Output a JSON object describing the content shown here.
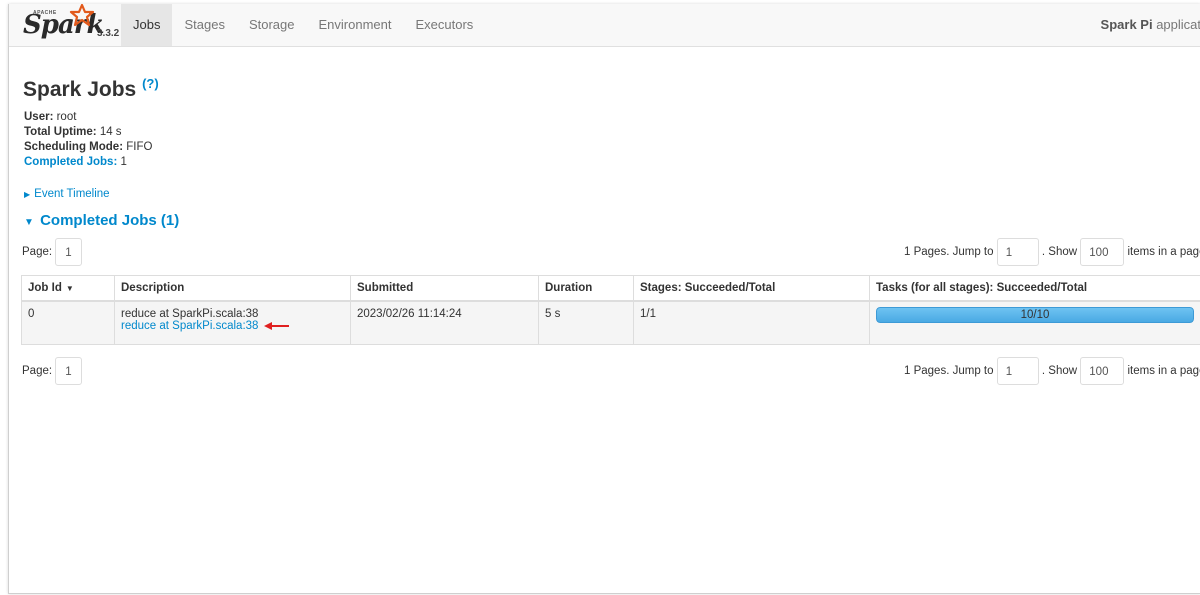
{
  "navbar": {
    "logo_text": "Spark",
    "logo_apache": "APACHE",
    "version": "3.3.2",
    "tabs": [
      {
        "label": "Jobs",
        "active": true
      },
      {
        "label": "Stages",
        "active": false
      },
      {
        "label": "Storage",
        "active": false
      },
      {
        "label": "Environment",
        "active": false
      },
      {
        "label": "Executors",
        "active": false
      }
    ],
    "app_name": "Spark Pi",
    "app_suffix": " applicat"
  },
  "page": {
    "title": "Spark Jobs",
    "help": "(?)"
  },
  "summary": {
    "user_label": "User:",
    "user_value": " root",
    "uptime_label": "Total Uptime:",
    "uptime_value": " 14 s",
    "mode_label": "Scheduling Mode:",
    "mode_value": " FIFO",
    "completed_label": "Completed Jobs:",
    "completed_value": " 1"
  },
  "event_timeline": "Event Timeline",
  "completed_jobs_header": "Completed Jobs (1)",
  "pager": {
    "page_label": "Page:",
    "page_value": "1",
    "pages_text": "1 Pages. Jump to",
    "jump_value": "1",
    "show_text": ". Show",
    "show_value": "100",
    "items_text": "items in a page."
  },
  "table": {
    "headers": [
      "Job Id",
      "Description",
      "Submitted",
      "Duration",
      "Stages: Succeeded/Total",
      "Tasks (for all stages): Succeeded/Total"
    ],
    "sort_indicator": "▼",
    "rows": [
      {
        "job_id": "0",
        "description": "reduce at SparkPi.scala:38",
        "description_link": "reduce at SparkPi.scala:38",
        "submitted": "2023/02/26 11:14:24",
        "duration": "5 s",
        "stages": "1/1",
        "tasks_text": "10/10",
        "tasks_progress": 1.0
      }
    ]
  },
  "colors": {
    "link": "#0088cc",
    "progress": "#4aa9e3",
    "annotation_arrow": "#e02020"
  }
}
